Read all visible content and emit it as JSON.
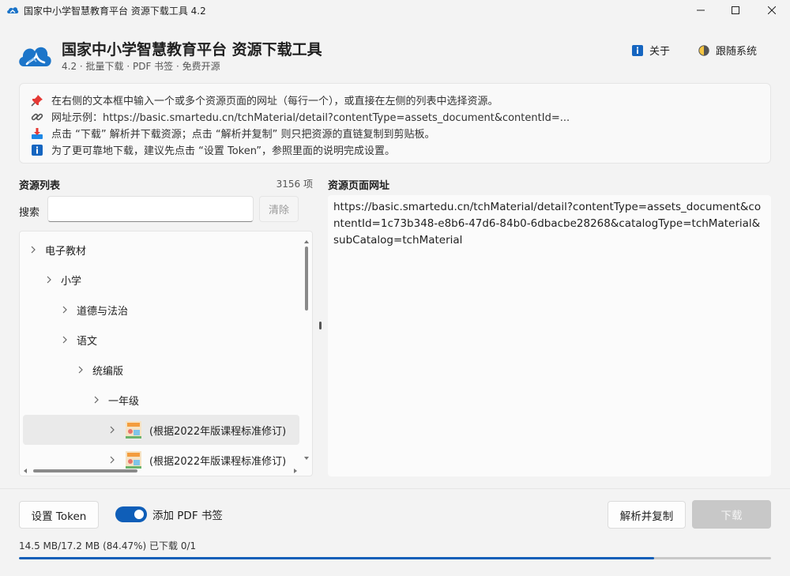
{
  "window": {
    "title": "国家中小学智慧教育平台 资源下载工具 4.2"
  },
  "header": {
    "title": "国家中小学智慧教育平台 资源下载工具",
    "subtitle": "4.2 · 批量下载 · PDF 书签 · 免费开源",
    "about_label": "关于",
    "theme_label": "跟随系统"
  },
  "info": {
    "lines": [
      {
        "icon": "pushpin-icon",
        "text": "在右侧的文本框中输入一个或多个资源页面的网址（每行一个），或直接在左侧的列表中选择资源。"
      },
      {
        "icon": "link-icon",
        "text": "网址示例：https://basic.smartedu.cn/tchMaterial/detail?contentType=assets_document&contentId=..."
      },
      {
        "icon": "download-tray-icon",
        "text": "点击 “下载” 解析并下载资源；点击 “解析并复制” 则只把资源的直链复制到剪贴板。"
      },
      {
        "icon": "info-icon",
        "text": "为了更可靠地下载，建议先点击 “设置 Token”，参照里面的说明完成设置。"
      }
    ]
  },
  "resources": {
    "section_label": "资源列表",
    "count": "3156 项",
    "search_label": "搜索",
    "search_value": "",
    "clear_label": "清除",
    "tree": [
      {
        "label": "电子教材",
        "level": 0,
        "thumb": false,
        "selected": false
      },
      {
        "label": "小学",
        "level": 1,
        "thumb": false,
        "selected": false
      },
      {
        "label": "道德与法治",
        "level": 2,
        "thumb": false,
        "selected": false
      },
      {
        "label": "语文",
        "level": 2,
        "thumb": false,
        "selected": false
      },
      {
        "label": "统编版",
        "level": 3,
        "thumb": false,
        "selected": false
      },
      {
        "label": "一年级",
        "level": 4,
        "thumb": false,
        "selected": false
      },
      {
        "label": "(根据2022年版课程标准修订)",
        "level": 5,
        "thumb": true,
        "selected": true
      },
      {
        "label": "(根据2022年版课程标准修订)",
        "level": 5,
        "thumb": true,
        "selected": false
      }
    ]
  },
  "url_panel": {
    "section_label": "资源页面网址",
    "value": "https://basic.smartedu.cn/tchMaterial/detail?contentType=assets_document&contentId=1c73b348-e8b6-47d6-84b0-6dbacbe28268&catalogType=tchMaterial&subCatalog=tchMaterial"
  },
  "footer": {
    "token_label": "设置 Token",
    "bookmark_label": "添加 PDF 书签",
    "bookmark_on": true,
    "copy_label": "解析并复制",
    "download_label": "下载",
    "status": "14.5 MB/17.2 MB (84.47%) 已下载 0/1",
    "progress_fraction": 0.8447
  },
  "colors": {
    "accent": "#0f5eb8",
    "disabled": "#c8c8c8"
  }
}
